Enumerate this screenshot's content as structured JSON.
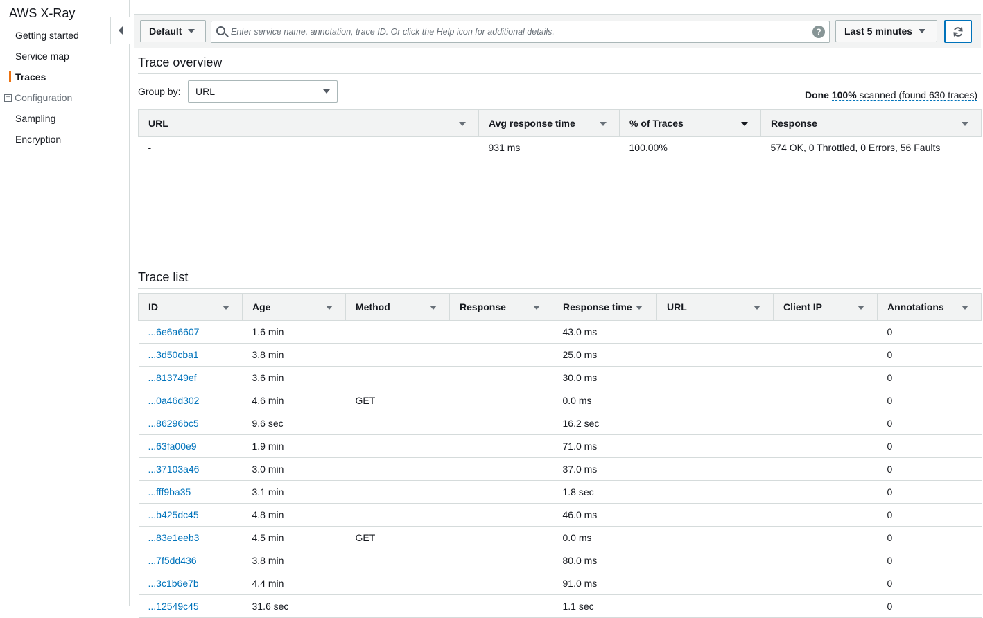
{
  "sidebar": {
    "title": "AWS X-Ray",
    "items": [
      {
        "label": "Getting started"
      },
      {
        "label": "Service map"
      },
      {
        "label": "Traces"
      }
    ],
    "group": {
      "label": "Configuration",
      "items": [
        {
          "label": "Sampling"
        },
        {
          "label": "Encryption"
        }
      ]
    }
  },
  "toolbar": {
    "group_label": "Default",
    "search_placeholder": "Enter service name, annotation, trace ID. Or click the Help icon for additional details.",
    "help_glyph": "?",
    "time_range_label": "Last 5 minutes"
  },
  "overview": {
    "title": "Trace overview",
    "group_by_label": "Group by:",
    "group_by_value": "URL",
    "status_done": "Done",
    "status_percent": "100%",
    "status_text": "scanned (found 630 traces)",
    "columns": [
      "URL",
      "Avg response time",
      "% of Traces",
      "Response"
    ],
    "rows": [
      [
        "-",
        "931 ms",
        "100.00%",
        "574 OK, 0 Throttled, 0 Errors, 56 Faults"
      ]
    ]
  },
  "trace_list": {
    "title": "Trace list",
    "columns": [
      "ID",
      "Age",
      "Method",
      "Response",
      "Response time",
      "URL",
      "Client IP",
      "Annotations"
    ],
    "rows": [
      [
        "...6e6a6607",
        "1.6 min",
        "",
        "",
        "43.0 ms",
        "",
        "",
        "0"
      ],
      [
        "...3d50cba1",
        "3.8 min",
        "",
        "",
        "25.0 ms",
        "",
        "",
        "0"
      ],
      [
        "...813749ef",
        "3.6 min",
        "",
        "",
        "30.0 ms",
        "",
        "",
        "0"
      ],
      [
        "...0a46d302",
        "4.6 min",
        "GET",
        "",
        "0.0 ms",
        "",
        "",
        "0"
      ],
      [
        "...86296bc5",
        "9.6 sec",
        "",
        "",
        "16.2 sec",
        "",
        "",
        "0"
      ],
      [
        "...63fa00e9",
        "1.9 min",
        "",
        "",
        "71.0 ms",
        "",
        "",
        "0"
      ],
      [
        "...37103a46",
        "3.0 min",
        "",
        "",
        "37.0 ms",
        "",
        "",
        "0"
      ],
      [
        "...fff9ba35",
        "3.1 min",
        "",
        "",
        "1.8 sec",
        "",
        "",
        "0"
      ],
      [
        "...b425dc45",
        "4.8 min",
        "",
        "",
        "46.0 ms",
        "",
        "",
        "0"
      ],
      [
        "...83e1eeb3",
        "4.5 min",
        "GET",
        "",
        "0.0 ms",
        "",
        "",
        "0"
      ],
      [
        "...7f5dd436",
        "3.8 min",
        "",
        "",
        "80.0 ms",
        "",
        "",
        "0"
      ],
      [
        "...3c1b6e7b",
        "4.4 min",
        "",
        "",
        "91.0 ms",
        "",
        "",
        "0"
      ],
      [
        "...12549c45",
        "31.6 sec",
        "",
        "",
        "1.1 sec",
        "",
        "",
        "0"
      ]
    ]
  },
  "colors": {
    "accent": "#ec7211",
    "link": "#0073bb",
    "header_bg": "#f2f3f3",
    "border": "#d5dbdb"
  }
}
